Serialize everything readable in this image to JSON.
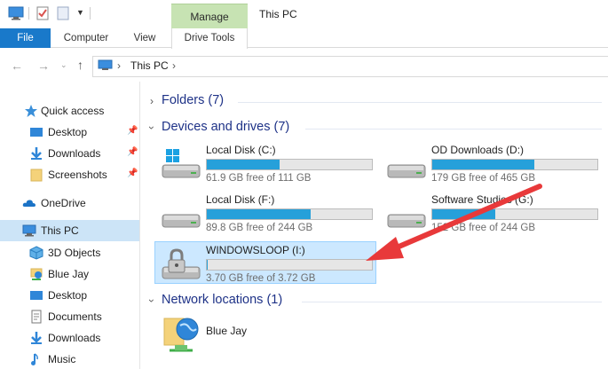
{
  "window": {
    "title": "This PC",
    "context_tab": "Manage"
  },
  "ribbon": {
    "tabs": [
      {
        "label": "File"
      },
      {
        "label": "Computer"
      },
      {
        "label": "View"
      },
      {
        "label": "Drive Tools"
      }
    ]
  },
  "address": {
    "segments": [
      "This PC"
    ]
  },
  "sidebar": {
    "items": [
      {
        "label": "Quick access",
        "icon": "star-icon"
      },
      {
        "label": "Desktop",
        "icon": "desktop-folder-icon",
        "pinned": true
      },
      {
        "label": "Downloads",
        "icon": "downloads-icon",
        "pinned": true
      },
      {
        "label": "Screenshots",
        "icon": "folder-icon",
        "pinned": true
      },
      {
        "label": "OneDrive",
        "icon": "cloud-icon"
      },
      {
        "label": "This PC",
        "icon": "computer-icon",
        "selected": true
      },
      {
        "label": "3D Objects",
        "icon": "3d-objects-icon"
      },
      {
        "label": "Blue Jay",
        "icon": "network-drive-icon"
      },
      {
        "label": "Desktop",
        "icon": "desktop-folder-icon"
      },
      {
        "label": "Documents",
        "icon": "documents-icon"
      },
      {
        "label": "Downloads",
        "icon": "downloads-icon"
      },
      {
        "label": "Music",
        "icon": "music-icon"
      }
    ]
  },
  "main": {
    "groups": {
      "folders": "Folders (7)",
      "devices": "Devices and drives (7)",
      "network": "Network locations (1)"
    },
    "drives": [
      {
        "name": "Local Disk (C:)",
        "free": "61.9 GB free of 111 GB",
        "used_fraction": 0.44,
        "icon": "windows-drive-icon"
      },
      {
        "name": "OD Downloads  (D:)",
        "free": "179 GB free of 465 GB",
        "used_fraction": 0.62,
        "icon": "hard-drive-icon"
      },
      {
        "name": "Local Disk (F:)",
        "free": "89.8 GB free of 244 GB",
        "used_fraction": 0.63,
        "icon": "hard-drive-icon"
      },
      {
        "name": "Software Studies (G:)",
        "free": "152 GB free of 244 GB",
        "used_fraction": 0.38,
        "icon": "hard-drive-icon"
      },
      {
        "name": "WINDOWSLOOP (I:)",
        "free": "3.70 GB free of 3.72 GB",
        "used_fraction": 0.005,
        "icon": "locked-drive-icon",
        "selected": true
      }
    ],
    "network_locations": [
      {
        "name": "Blue Jay",
        "icon": "network-location-icon"
      }
    ]
  },
  "colors": {
    "accent": "#1979ca",
    "bar_fill": "#26a0da",
    "selection": "#cce4f7",
    "annotation_arrow": "#e8393a",
    "group_title": "#1e3287"
  }
}
